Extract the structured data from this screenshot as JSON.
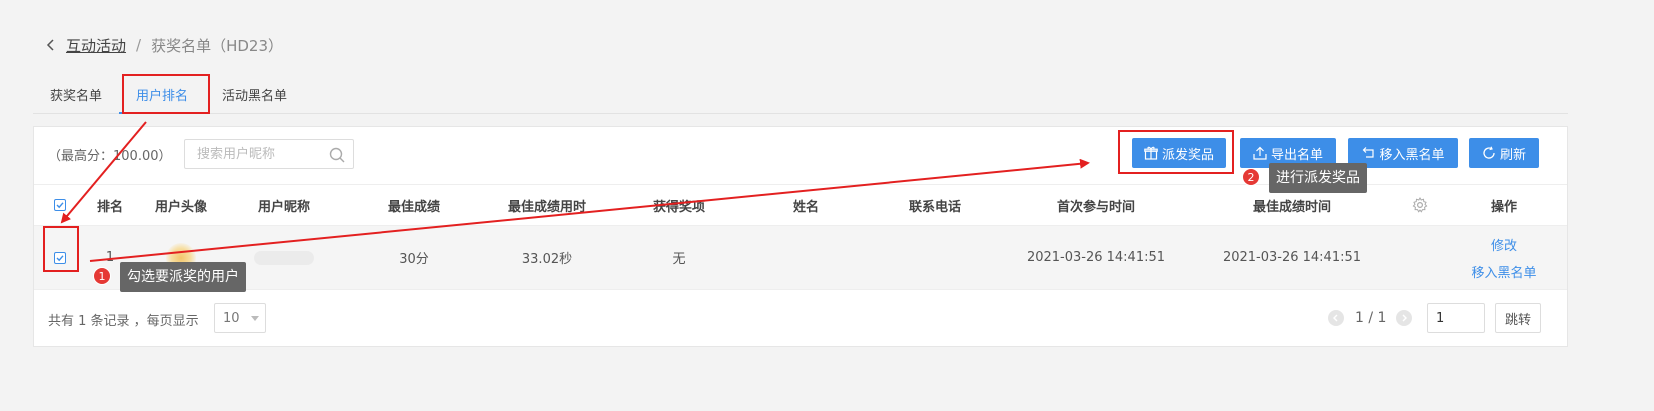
{
  "breadcrumb": {
    "link": "互动活动",
    "separator": "/",
    "current": "获奖名单（HD23）"
  },
  "tabs": [
    "获奖名单",
    "用户排名",
    "活动黑名单"
  ],
  "toolbar": {
    "max_score": "（最高分：100.00）",
    "search_placeholder": "搜索用户昵称",
    "buttons": {
      "distribute": "派发奖品",
      "export": "导出名单",
      "blacklist": "移入黑名单",
      "refresh": "刷新"
    }
  },
  "table": {
    "columns": [
      "排名",
      "用户头像",
      "用户昵称",
      "最佳成绩",
      "最佳成绩用时",
      "获得奖项",
      "姓名",
      "联系电话",
      "首次参与时间",
      "最佳成绩时间",
      "操作"
    ],
    "rows": [
      {
        "rank": "1",
        "score": "30分",
        "time_used": "33.02秒",
        "prize": "无",
        "name": "",
        "phone": "",
        "first_join": "2021-03-26 14:41:51",
        "best_time": "2021-03-26 14:41:51",
        "actions": [
          "修改",
          "移入黑名单"
        ],
        "checked": true
      }
    ]
  },
  "pagination": {
    "total": "共有 1 条记录 ，每页显示",
    "page_size": "10",
    "page_info": "1 / 1",
    "page_input": "1",
    "jump": "跳转"
  },
  "annotations": [
    {
      "number": "1",
      "text": "勾选要派奖的用户"
    },
    {
      "number": "2",
      "text": "进行派发奖品"
    }
  ],
  "colors": {
    "accent": "#3d8ee8",
    "annotation_red": "#e32020",
    "tooltip_bg": "#666666"
  }
}
